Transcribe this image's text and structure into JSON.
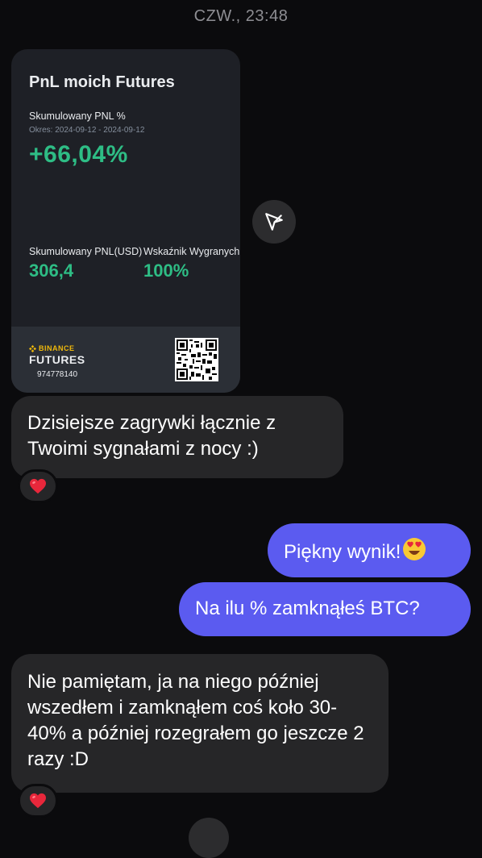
{
  "timestamp": "CZW., 23:48",
  "pnl_card": {
    "title": "PnL moich Futures",
    "cumulative_pnl_pct_label": "Skumulowany PNL %",
    "period": "Okres: 2024-09-12 - 2024-09-12",
    "cumulative_pnl_pct_value": "+66,04%",
    "cumulative_pnl_usd_label": "Skumulowany PNL(USD)",
    "cumulative_pnl_usd_value": "306,4",
    "win_rate_label": "Wskaźnik Wygranych",
    "win_rate_value": "100%",
    "brand_top": "BINANCE",
    "brand_bottom": "FUTURES",
    "account_id": "974778140"
  },
  "messages": [
    {
      "side": "incoming",
      "text": "Dzisiejsze zagrywki łącznie z Twoimi sygnałami z nocy :)",
      "reaction": "heart"
    },
    {
      "side": "outgoing",
      "text": "Piękny wynik!",
      "emoji": "heart-eyes-emoji"
    },
    {
      "side": "outgoing",
      "text": "Na ilu % zamknąłeś BTC?"
    },
    {
      "side": "incoming",
      "text": "Nie pamiętam, ja na niego później wszedłem i zamknąłem coś koło 30-40% a później rozegrałem go jeszcze 2 razy :D",
      "reaction": "heart"
    }
  ],
  "colors": {
    "background": "#0b0b0d",
    "incoming_bubble": "#262628",
    "outgoing_bubble": "#5b5bf0",
    "profit_green": "#2ebd85",
    "binance_yellow": "#f0b90b"
  }
}
